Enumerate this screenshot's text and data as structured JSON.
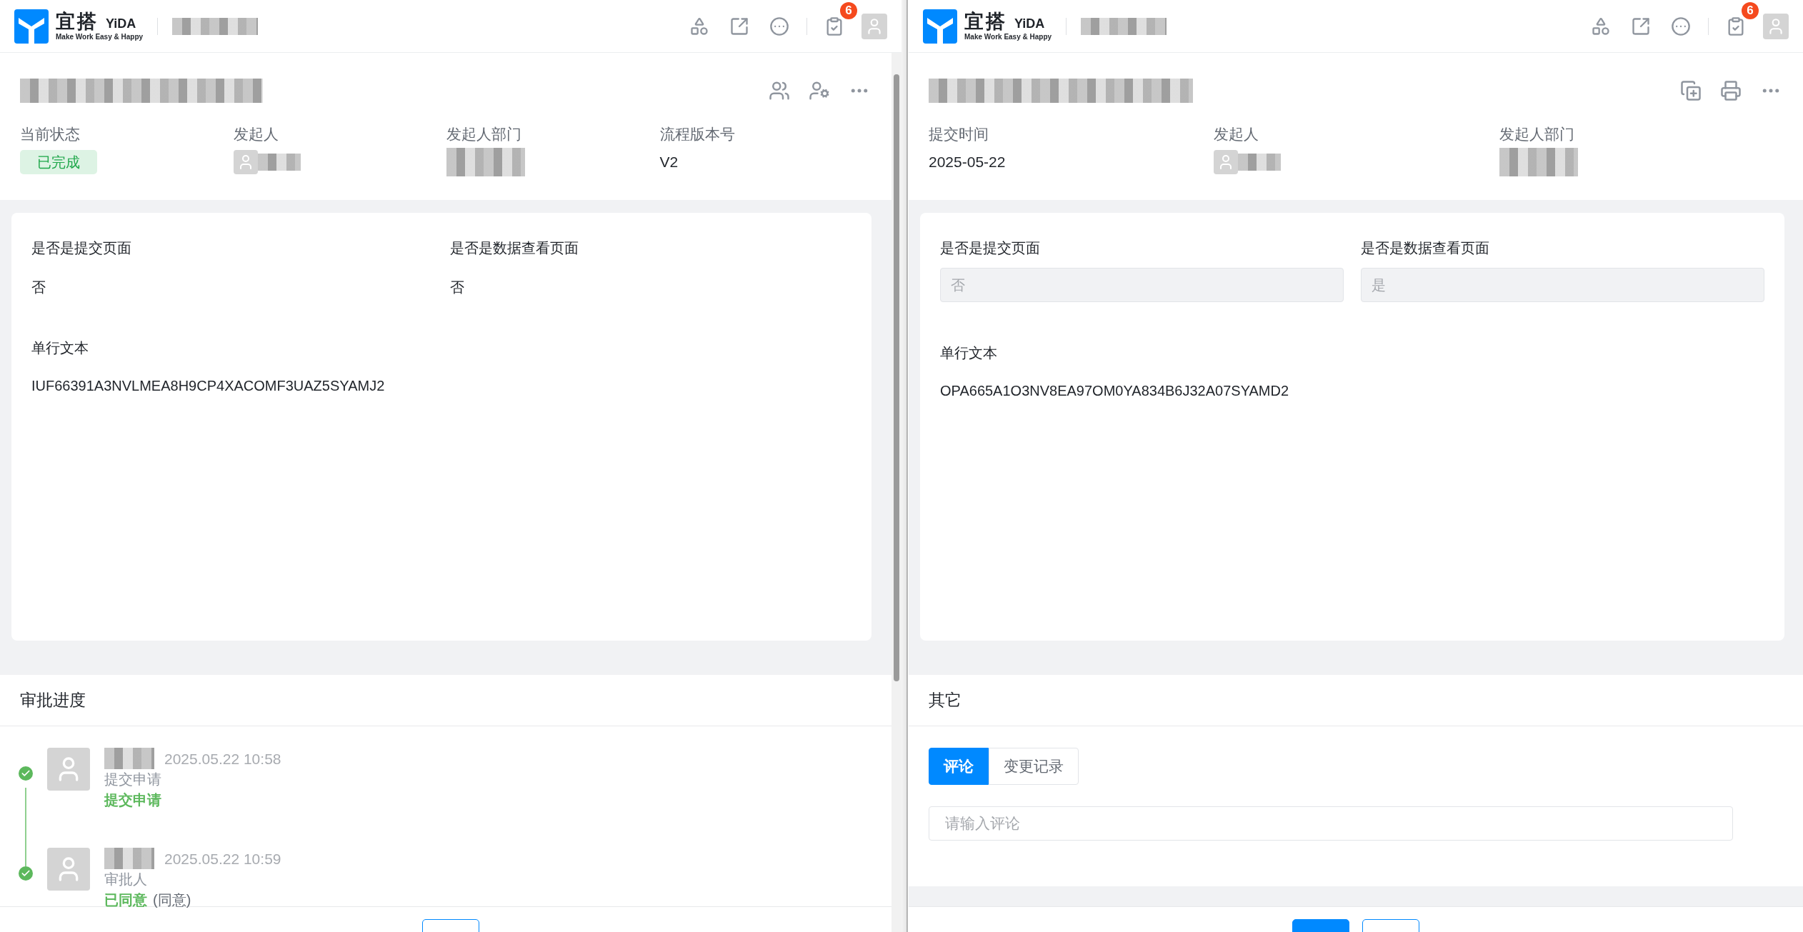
{
  "panes": [
    {
      "kind": "process",
      "topbar": {
        "logo_name": "宜搭",
        "logo_latin": "YiDA",
        "slogan": "Make Work Easy & Happy",
        "notification_count": "6"
      },
      "meta": [
        {
          "label": "当前状态",
          "kind": "status",
          "value": "已完成"
        },
        {
          "label": "发起人",
          "kind": "person"
        },
        {
          "label": "发起人部门",
          "kind": "hidden"
        },
        {
          "label": "流程版本号",
          "kind": "text",
          "value": "V2"
        }
      ],
      "form": [
        {
          "label": "是否是提交页面",
          "kind": "text",
          "value": "否"
        },
        {
          "label": "是否是数据查看页面",
          "kind": "text",
          "value": "否"
        },
        {
          "label": "单行文本",
          "kind": "text",
          "value": "IUF66391A3NVLMEA8H9CP4XACOMF3UAZ5SYAMJ2"
        }
      ],
      "section": {
        "title": "审批进度",
        "timeline": [
          {
            "time": "2025.05.22 10:58",
            "role": "提交申请",
            "result": "提交申请",
            "done": true
          },
          {
            "time": "2025.05.22 10:59",
            "role": "审批人",
            "result": "已同意",
            "note": "(同意)",
            "done": true
          }
        ]
      },
      "footer_buttons": [
        {
          "kind": "outline"
        }
      ]
    },
    {
      "kind": "record",
      "topbar": {
        "logo_name": "宜搭",
        "logo_latin": "YiDA",
        "slogan": "Make Work Easy & Happy",
        "notification_count": "6"
      },
      "meta": [
        {
          "label": "提交时间",
          "kind": "text",
          "value": "2025-05-22"
        },
        {
          "label": "发起人",
          "kind": "person"
        },
        {
          "label": "发起人部门",
          "kind": "hidden"
        }
      ],
      "form": [
        {
          "label": "是否是提交页面",
          "kind": "input",
          "value": "否"
        },
        {
          "label": "是否是数据查看页面",
          "kind": "input",
          "value": "是"
        },
        {
          "label": "单行文本",
          "kind": "text",
          "value": "OPA665A1O3NV8EA97OM0YA834B6J32A07SYAMD2"
        }
      ],
      "section": {
        "title": "其它",
        "tabs": [
          {
            "label": "评论",
            "selected": true
          },
          {
            "label": "变更记录",
            "selected": false
          }
        ],
        "comment": {
          "placeholder": "请输入评论"
        }
      },
      "footer_buttons": [
        {
          "kind": "primary"
        },
        {
          "kind": "outline"
        }
      ]
    }
  ]
}
